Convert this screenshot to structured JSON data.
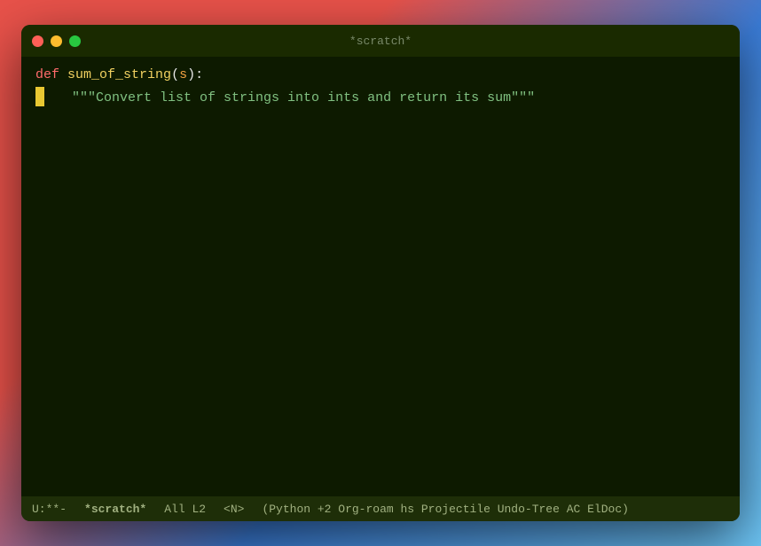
{
  "window": {
    "title": "*scratch*",
    "traffic_lights": {
      "close_label": "close",
      "minimize_label": "minimize",
      "maximize_label": "maximize"
    }
  },
  "editor": {
    "lines": [
      {
        "type": "def",
        "def_kw": "def",
        "func_name": "sum_of_string(s):",
        "indent": ""
      },
      {
        "type": "docstring",
        "indent": "    ",
        "content": "\"\"\"Convert list of strings into ints and return its sum\"\"\""
      }
    ]
  },
  "statusbar": {
    "mode": "U:**-",
    "buffer": "*scratch*",
    "position": "All L2",
    "narrowing": "<N>",
    "modes": "(Python +2 Org-roam hs Projectile Undo-Tree AC ElDoc)"
  }
}
